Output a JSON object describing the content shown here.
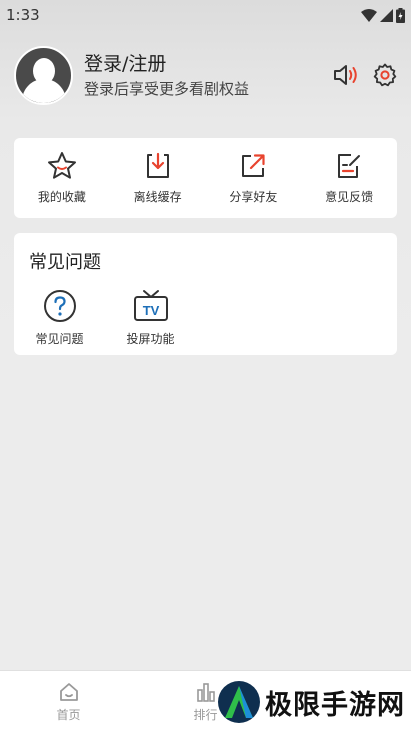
{
  "status": {
    "time": "1:33"
  },
  "profile": {
    "title": "登录/注册",
    "subtitle": "登录后享受更多看剧权益"
  },
  "quick_actions": [
    {
      "label": "我的收藏",
      "icon": "star-icon"
    },
    {
      "label": "离线缓存",
      "icon": "download-icon"
    },
    {
      "label": "分享好友",
      "icon": "share-icon"
    },
    {
      "label": "意见反馈",
      "icon": "feedback-icon"
    }
  ],
  "faq_section": {
    "title": "常见问题",
    "items": [
      {
        "label": "常见问题",
        "icon": "question-icon"
      },
      {
        "label": "投屏功能",
        "icon": "tv-icon",
        "icon_text": "TV"
      }
    ]
  },
  "tabbar": {
    "tabs": [
      {
        "label": "首页",
        "icon": "home-icon"
      },
      {
        "label": "排行",
        "icon": "rank-icon"
      }
    ]
  },
  "watermark": {
    "text": "极限手游网"
  },
  "colors": {
    "accent_red": "#e8432e",
    "icon_dark": "#333333",
    "icon_blue": "#1d6fb8"
  }
}
